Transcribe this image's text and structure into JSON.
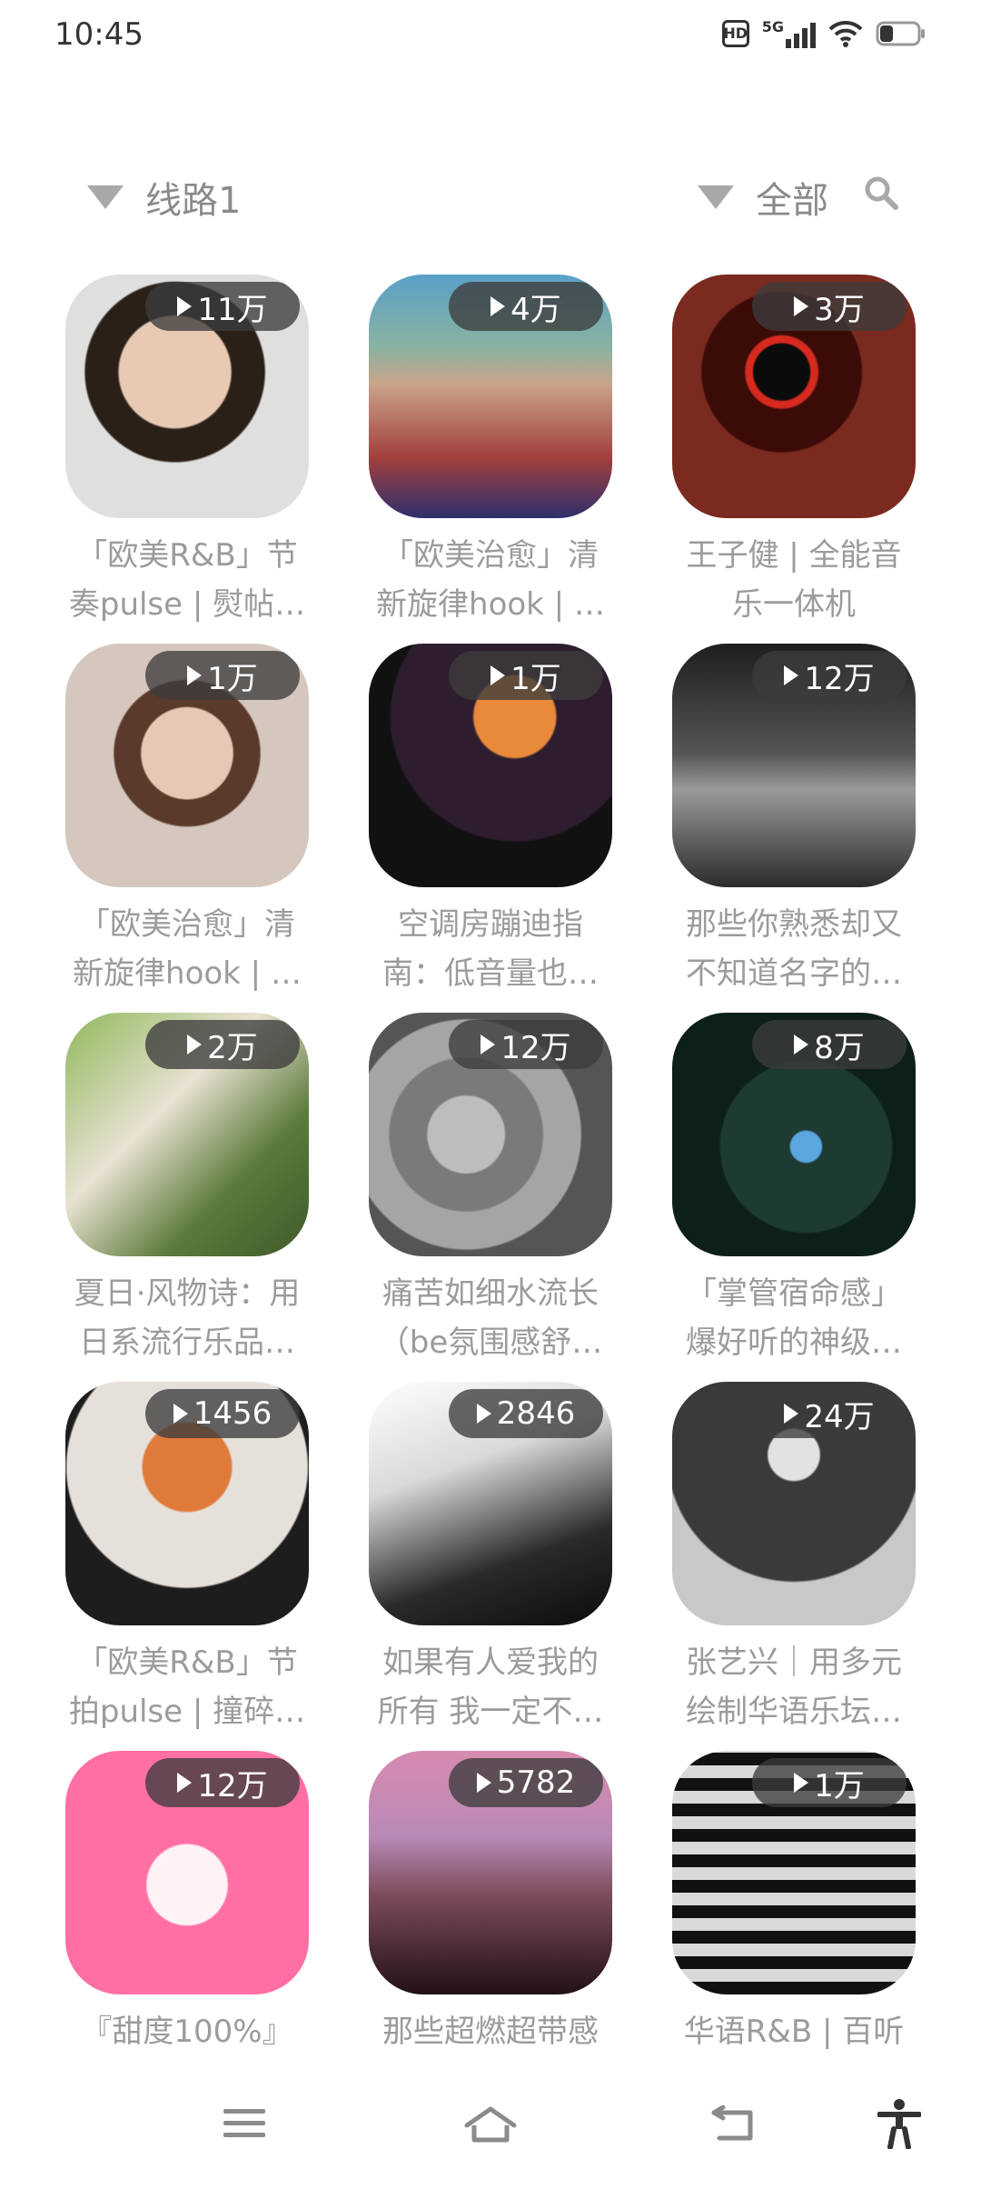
{
  "status_bar": {
    "time": "10:45",
    "network": "5G",
    "hd": "HD"
  },
  "filters": {
    "route_label": "线路1",
    "category_label": "全部"
  },
  "playlists": [
    {
      "plays": "11万",
      "title": "「欧美R&B」节奏pulse | 熨帖…"
    },
    {
      "plays": "4万",
      "title": "「欧美治愈」清新旋律hook | …"
    },
    {
      "plays": "3万",
      "title": "王子健 | 全能音乐一体机"
    },
    {
      "plays": "1万",
      "title": "「欧美治愈」清新旋律hook | …"
    },
    {
      "plays": "1万",
      "title": "空调房蹦迪指南：低音量也…"
    },
    {
      "plays": "12万",
      "title": "那些你熟悉却又不知道名字的…"
    },
    {
      "plays": "2万",
      "title": "夏日·风物诗：用日系流行乐品…"
    },
    {
      "plays": "12万",
      "title": "痛苦如细水流长（be氛围感舒…"
    },
    {
      "plays": "8万",
      "title": "「掌管宿命感」爆好听的神级…"
    },
    {
      "plays": "1456",
      "title": "「欧美R&B」节拍pulse | 撞碎…"
    },
    {
      "plays": "2846",
      "title": "如果有人爱我的所有 我一定不…"
    },
    {
      "plays": "24万",
      "title": "张艺兴｜用多元绘制华语乐坛…"
    },
    {
      "plays": "12万",
      "title": "『甜度100%』"
    },
    {
      "plays": "5782",
      "title": "那些超燃超带感"
    },
    {
      "plays": "1万",
      "title": "华语R&B | 百听"
    }
  ],
  "colors": {
    "text": "#9b9b9b",
    "badge_bg": "#3c3c3c",
    "icon": "#a8a8a8"
  },
  "nav_icons": [
    "menu-icon",
    "home-icon",
    "back-icon",
    "accessibility-icon"
  ]
}
